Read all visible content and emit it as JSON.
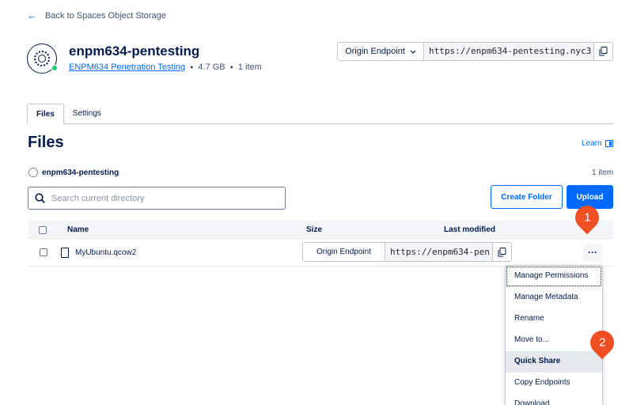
{
  "nav": {
    "back_label": "Back to Spaces Object Storage"
  },
  "bucket": {
    "name": "enpm634-pentesting",
    "project": "ENPM634 Penetration Testing",
    "size": "4.7 GB",
    "item_count": "1 item"
  },
  "endpoint": {
    "select_label": "Origin Endpoint",
    "url": "https://enpm634-pentesting.nyc3"
  },
  "tabs": [
    {
      "label": "Files"
    },
    {
      "label": "Settings"
    }
  ],
  "main": {
    "heading": "Files",
    "learn_label": "Learn",
    "breadcrumb": "enpm634-pentesting",
    "item_count": "1 item"
  },
  "search": {
    "placeholder": "Search current directory"
  },
  "actions": {
    "create_folder": "Create Folder",
    "upload": "Upload"
  },
  "table": {
    "columns": [
      "Name",
      "Size",
      "Last modified"
    ],
    "rows": [
      {
        "name": "MyUbuntu.qcow2",
        "endpoint_label": "Origin Endpoint",
        "endpoint_url": "https://enpm634-pen"
      }
    ]
  },
  "context_menu": {
    "items": [
      "Manage Permissions",
      "Manage Metadata",
      "Rename",
      "Move to...",
      "Quick Share",
      "Copy Endpoints",
      "Download"
    ]
  },
  "callouts": [
    "1",
    "2"
  ],
  "colors": {
    "accent": "#0069ff",
    "callout": "#f04e23",
    "status": "#15cd72"
  }
}
